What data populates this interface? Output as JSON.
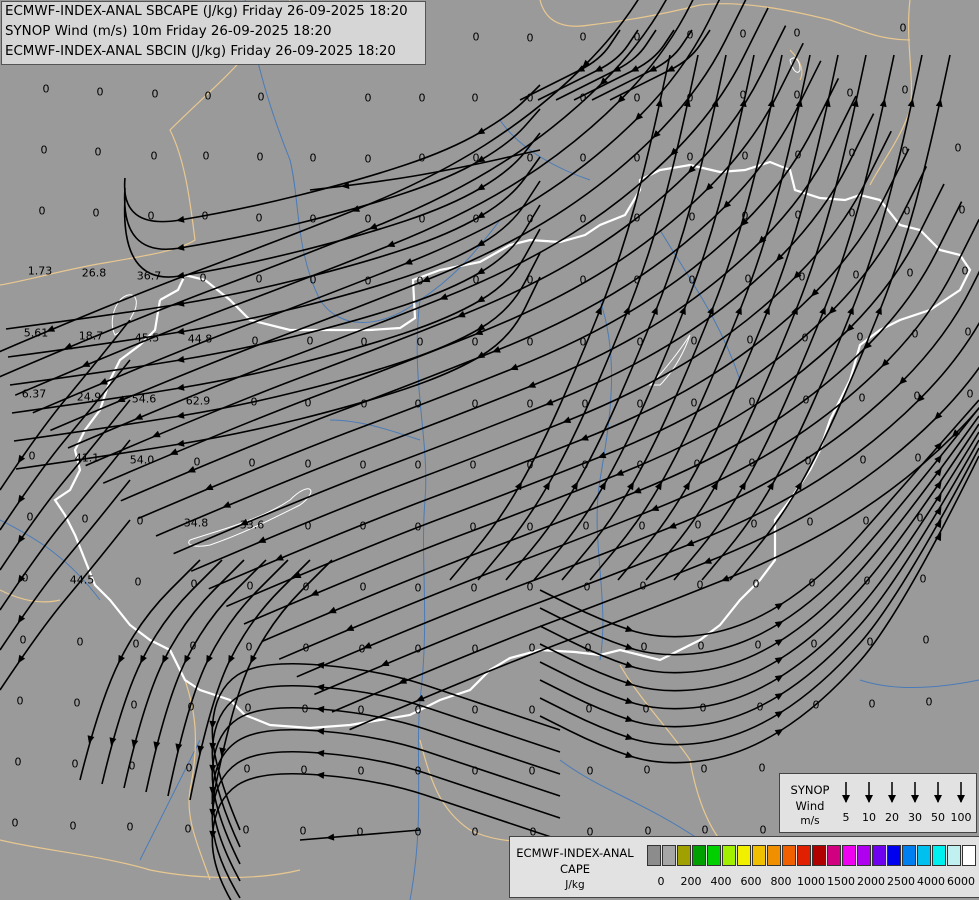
{
  "header": {
    "line1": "ECMWF-INDEX-ANAL SBCAPE (J/kg) Friday 26-09-2025 18:20",
    "line2": "SYNOP Wind (m/s) 10m Friday 26-09-2025 18:20",
    "line3": "ECMWF-INDEX-ANAL SBCIN (J/kg) Friday 26-09-2025 18:20"
  },
  "colors": {
    "map_background": "#9a9a9a",
    "streamline": "#000000",
    "country_border": "#ffffff",
    "neighbor_border": "#e8c890",
    "river": "#4a7bb8"
  },
  "values": [
    {
      "t": "0",
      "p": [
        46,
        89
      ]
    },
    {
      "t": "0",
      "p": [
        100,
        92
      ]
    },
    {
      "t": "0",
      "p": [
        155,
        94
      ]
    },
    {
      "t": "0",
      "p": [
        208,
        96
      ]
    },
    {
      "t": "0",
      "p": [
        261,
        97
      ]
    },
    {
      "t": "0",
      "p": [
        368,
        98
      ]
    },
    {
      "t": "0",
      "p": [
        422,
        98
      ]
    },
    {
      "t": "0",
      "p": [
        475,
        98
      ]
    },
    {
      "t": "0",
      "p": [
        530,
        98
      ]
    },
    {
      "t": "0",
      "p": [
        583,
        98
      ]
    },
    {
      "t": "0",
      "p": [
        637,
        98
      ]
    },
    {
      "t": "0",
      "p": [
        690,
        98
      ]
    },
    {
      "t": "0",
      "p": [
        743,
        95
      ]
    },
    {
      "t": "0",
      "p": [
        797,
        95
      ]
    },
    {
      "t": "0",
      "p": [
        850,
        93
      ]
    },
    {
      "t": "0",
      "p": [
        905,
        90
      ]
    },
    {
      "t": "0",
      "p": [
        476,
        37
      ]
    },
    {
      "t": "0",
      "p": [
        530,
        38
      ]
    },
    {
      "t": "0",
      "p": [
        583,
        37
      ]
    },
    {
      "t": "0",
      "p": [
        637,
        37
      ]
    },
    {
      "t": "0",
      "p": [
        690,
        35
      ]
    },
    {
      "t": "0",
      "p": [
        743,
        34
      ]
    },
    {
      "t": "0",
      "p": [
        797,
        33
      ]
    },
    {
      "t": "0",
      "p": [
        903,
        28
      ]
    },
    {
      "t": "0",
      "p": [
        44,
        150
      ]
    },
    {
      "t": "0",
      "p": [
        98,
        152
      ]
    },
    {
      "t": "0",
      "p": [
        154,
        156
      ]
    },
    {
      "t": "0",
      "p": [
        206,
        156
      ]
    },
    {
      "t": "0",
      "p": [
        260,
        157
      ]
    },
    {
      "t": "0",
      "p": [
        313,
        158
      ]
    },
    {
      "t": "0",
      "p": [
        368,
        159
      ]
    },
    {
      "t": "0",
      "p": [
        422,
        158
      ]
    },
    {
      "t": "0",
      "p": [
        476,
        158
      ]
    },
    {
      "t": "0",
      "p": [
        530,
        158
      ]
    },
    {
      "t": "0",
      "p": [
        583,
        158
      ]
    },
    {
      "t": "0",
      "p": [
        637,
        158
      ]
    },
    {
      "t": "0",
      "p": [
        690,
        157
      ]
    },
    {
      "t": "0",
      "p": [
        745,
        156
      ]
    },
    {
      "t": "0",
      "p": [
        798,
        155
      ]
    },
    {
      "t": "0",
      "p": [
        852,
        153
      ]
    },
    {
      "t": "0",
      "p": [
        905,
        151
      ]
    },
    {
      "t": "0",
      "p": [
        958,
        148
      ]
    },
    {
      "t": "0",
      "p": [
        42,
        211
      ]
    },
    {
      "t": "0",
      "p": [
        96,
        213
      ]
    },
    {
      "t": "0",
      "p": [
        151,
        216
      ]
    },
    {
      "t": "0",
      "p": [
        205,
        216
      ]
    },
    {
      "t": "0",
      "p": [
        259,
        218
      ]
    },
    {
      "t": "0",
      "p": [
        313,
        219
      ]
    },
    {
      "t": "0",
      "p": [
        368,
        219
      ]
    },
    {
      "t": "0",
      "p": [
        422,
        219
      ]
    },
    {
      "t": "0",
      "p": [
        476,
        219
      ]
    },
    {
      "t": "0",
      "p": [
        530,
        219
      ]
    },
    {
      "t": "0",
      "p": [
        583,
        219
      ]
    },
    {
      "t": "0",
      "p": [
        637,
        218
      ]
    },
    {
      "t": "0",
      "p": [
        692,
        217
      ]
    },
    {
      "t": "0",
      "p": [
        745,
        216
      ]
    },
    {
      "t": "0",
      "p": [
        798,
        215
      ]
    },
    {
      "t": "0",
      "p": [
        852,
        213
      ]
    },
    {
      "t": "0",
      "p": [
        907,
        211
      ]
    },
    {
      "t": "0",
      "p": [
        962,
        210
      ]
    },
    {
      "t": "1.73",
      "p": [
        40,
        271
      ]
    },
    {
      "t": "26.8",
      "p": [
        94,
        273
      ]
    },
    {
      "t": "36.7",
      "p": [
        149,
        276
      ]
    },
    {
      "t": "0",
      "p": [
        203,
        278
      ]
    },
    {
      "t": "0",
      "p": [
        259,
        279
      ]
    },
    {
      "t": "0",
      "p": [
        313,
        280
      ]
    },
    {
      "t": "0",
      "p": [
        368,
        281
      ]
    },
    {
      "t": "0",
      "p": [
        420,
        281
      ]
    },
    {
      "t": "0",
      "p": [
        476,
        280
      ]
    },
    {
      "t": "0",
      "p": [
        530,
        280
      ]
    },
    {
      "t": "0",
      "p": [
        583,
        280
      ]
    },
    {
      "t": "0",
      "p": [
        637,
        280
      ]
    },
    {
      "t": "0",
      "p": [
        692,
        280
      ]
    },
    {
      "t": "0",
      "p": [
        748,
        279
      ]
    },
    {
      "t": "0",
      "p": [
        802,
        277
      ]
    },
    {
      "t": "0",
      "p": [
        856,
        275
      ]
    },
    {
      "t": "0",
      "p": [
        910,
        273
      ]
    },
    {
      "t": "0",
      "p": [
        965,
        271
      ]
    },
    {
      "t": "5.61",
      "p": [
        36,
        333
      ]
    },
    {
      "t": "18.7",
      "p": [
        91,
        336
      ]
    },
    {
      "t": "45.5",
      "p": [
        147,
        338
      ]
    },
    {
      "t": "44.8",
      "p": [
        200,
        339
      ]
    },
    {
      "t": "0",
      "p": [
        255,
        341
      ]
    },
    {
      "t": "0",
      "p": [
        310,
        341
      ]
    },
    {
      "t": "0",
      "p": [
        364,
        342
      ]
    },
    {
      "t": "0",
      "p": [
        420,
        342
      ]
    },
    {
      "t": "0",
      "p": [
        475,
        342
      ]
    },
    {
      "t": "0",
      "p": [
        530,
        342
      ]
    },
    {
      "t": "0",
      "p": [
        583,
        342
      ]
    },
    {
      "t": "0",
      "p": [
        640,
        342
      ]
    },
    {
      "t": "0",
      "p": [
        694,
        341
      ]
    },
    {
      "t": "0",
      "p": [
        750,
        340
      ]
    },
    {
      "t": "0",
      "p": [
        805,
        338
      ]
    },
    {
      "t": "0",
      "p": [
        860,
        337
      ]
    },
    {
      "t": "0",
      "p": [
        915,
        334
      ]
    },
    {
      "t": "0",
      "p": [
        968,
        332
      ]
    },
    {
      "t": "6.37",
      "p": [
        34,
        394
      ]
    },
    {
      "t": "24.9",
      "p": [
        89,
        397
      ]
    },
    {
      "t": "54.6",
      "p": [
        144,
        399
      ]
    },
    {
      "t": "62.9",
      "p": [
        198,
        401
      ]
    },
    {
      "t": "0",
      "p": [
        254,
        402
      ]
    },
    {
      "t": "0",
      "p": [
        308,
        403
      ]
    },
    {
      "t": "0",
      "p": [
        364,
        404
      ]
    },
    {
      "t": "0",
      "p": [
        418,
        404
      ]
    },
    {
      "t": "0",
      "p": [
        475,
        404
      ]
    },
    {
      "t": "0",
      "p": [
        530,
        404
      ]
    },
    {
      "t": "0",
      "p": [
        585,
        404
      ]
    },
    {
      "t": "0",
      "p": [
        640,
        404
      ]
    },
    {
      "t": "0",
      "p": [
        694,
        403
      ]
    },
    {
      "t": "0",
      "p": [
        752,
        402
      ]
    },
    {
      "t": "0",
      "p": [
        806,
        400
      ]
    },
    {
      "t": "0",
      "p": [
        862,
        398
      ]
    },
    {
      "t": "0",
      "p": [
        917,
        396
      ]
    },
    {
      "t": "0",
      "p": [
        970,
        394
      ]
    },
    {
      "t": "0",
      "p": [
        32,
        456
      ]
    },
    {
      "t": "41.1",
      "p": [
        87,
        458
      ]
    },
    {
      "t": "54.0",
      "p": [
        142,
        460
      ]
    },
    {
      "t": "0",
      "p": [
        197,
        462
      ]
    },
    {
      "t": "0",
      "p": [
        252,
        463
      ]
    },
    {
      "t": "0",
      "p": [
        308,
        464
      ]
    },
    {
      "t": "0",
      "p": [
        363,
        465
      ]
    },
    {
      "t": "0",
      "p": [
        418,
        465
      ]
    },
    {
      "t": "0",
      "p": [
        473,
        465
      ]
    },
    {
      "t": "0",
      "p": [
        530,
        465
      ]
    },
    {
      "t": "0",
      "p": [
        585,
        465
      ]
    },
    {
      "t": "0",
      "p": [
        640,
        465
      ]
    },
    {
      "t": "0",
      "p": [
        697,
        464
      ]
    },
    {
      "t": "0",
      "p": [
        752,
        463
      ]
    },
    {
      "t": "0",
      "p": [
        808,
        461
      ]
    },
    {
      "t": "0",
      "p": [
        863,
        460
      ]
    },
    {
      "t": "0",
      "p": [
        918,
        458
      ]
    },
    {
      "t": "0",
      "p": [
        30,
        517
      ]
    },
    {
      "t": "0",
      "p": [
        85,
        519
      ]
    },
    {
      "t": "0",
      "p": [
        140,
        521
      ]
    },
    {
      "t": "34.8",
      "p": [
        196,
        523
      ]
    },
    {
      "t": "33.6",
      "p": [
        252,
        525
      ]
    },
    {
      "t": "0",
      "p": [
        308,
        526
      ]
    },
    {
      "t": "0",
      "p": [
        363,
        526
      ]
    },
    {
      "t": "0",
      "p": [
        418,
        527
      ]
    },
    {
      "t": "0",
      "p": [
        473,
        527
      ]
    },
    {
      "t": "0",
      "p": [
        530,
        527
      ]
    },
    {
      "t": "0",
      "p": [
        586,
        526
      ]
    },
    {
      "t": "0",
      "p": [
        642,
        526
      ]
    },
    {
      "t": "0",
      "p": [
        698,
        525
      ]
    },
    {
      "t": "0",
      "p": [
        754,
        524
      ]
    },
    {
      "t": "0",
      "p": [
        810,
        522
      ]
    },
    {
      "t": "0",
      "p": [
        866,
        521
      ]
    },
    {
      "t": "0",
      "p": [
        920,
        518
      ]
    },
    {
      "t": "0",
      "p": [
        25,
        578
      ]
    },
    {
      "t": "44.5",
      "p": [
        82,
        580
      ]
    },
    {
      "t": "0",
      "p": [
        138,
        582
      ]
    },
    {
      "t": "0",
      "p": [
        194,
        584
      ]
    },
    {
      "t": "0",
      "p": [
        250,
        586
      ]
    },
    {
      "t": "0",
      "p": [
        306,
        587
      ]
    },
    {
      "t": "0",
      "p": [
        363,
        587
      ]
    },
    {
      "t": "0",
      "p": [
        418,
        588
      ]
    },
    {
      "t": "0",
      "p": [
        474,
        588
      ]
    },
    {
      "t": "0",
      "p": [
        530,
        587
      ]
    },
    {
      "t": "0",
      "p": [
        587,
        587
      ]
    },
    {
      "t": "0",
      "p": [
        643,
        586
      ]
    },
    {
      "t": "0",
      "p": [
        700,
        585
      ]
    },
    {
      "t": "0",
      "p": [
        756,
        584
      ]
    },
    {
      "t": "0",
      "p": [
        812,
        583
      ]
    },
    {
      "t": "0",
      "p": [
        867,
        581
      ]
    },
    {
      "t": "0",
      "p": [
        923,
        579
      ]
    },
    {
      "t": "0",
      "p": [
        23,
        640
      ]
    },
    {
      "t": "0",
      "p": [
        80,
        642
      ]
    },
    {
      "t": "0",
      "p": [
        136,
        644
      ]
    },
    {
      "t": "0",
      "p": [
        193,
        646
      ]
    },
    {
      "t": "0",
      "p": [
        249,
        647
      ]
    },
    {
      "t": "0",
      "p": [
        306,
        648
      ]
    },
    {
      "t": "0",
      "p": [
        362,
        649
      ]
    },
    {
      "t": "0",
      "p": [
        418,
        649
      ]
    },
    {
      "t": "0",
      "p": [
        475,
        649
      ]
    },
    {
      "t": "0",
      "p": [
        532,
        648
      ]
    },
    {
      "t": "0",
      "p": [
        588,
        648
      ]
    },
    {
      "t": "0",
      "p": [
        644,
        647
      ]
    },
    {
      "t": "0",
      "p": [
        701,
        646
      ]
    },
    {
      "t": "0",
      "p": [
        758,
        645
      ]
    },
    {
      "t": "0",
      "p": [
        814,
        644
      ]
    },
    {
      "t": "0",
      "p": [
        870,
        642
      ]
    },
    {
      "t": "0",
      "p": [
        926,
        640
      ]
    },
    {
      "t": "0",
      "p": [
        20,
        701
      ]
    },
    {
      "t": "0",
      "p": [
        77,
        703
      ]
    },
    {
      "t": "0",
      "p": [
        134,
        705
      ]
    },
    {
      "t": "0",
      "p": [
        191,
        707
      ]
    },
    {
      "t": "0",
      "p": [
        248,
        708
      ]
    },
    {
      "t": "0",
      "p": [
        305,
        709
      ]
    },
    {
      "t": "0",
      "p": [
        361,
        710
      ]
    },
    {
      "t": "0",
      "p": [
        418,
        710
      ]
    },
    {
      "t": "0",
      "p": [
        475,
        710
      ]
    },
    {
      "t": "0",
      "p": [
        532,
        710
      ]
    },
    {
      "t": "0",
      "p": [
        589,
        709
      ]
    },
    {
      "t": "0",
      "p": [
        646,
        709
      ]
    },
    {
      "t": "0",
      "p": [
        703,
        708
      ]
    },
    {
      "t": "0",
      "p": [
        760,
        707
      ]
    },
    {
      "t": "0",
      "p": [
        816,
        705
      ]
    },
    {
      "t": "0",
      "p": [
        872,
        704
      ]
    },
    {
      "t": "0",
      "p": [
        929,
        702
      ]
    },
    {
      "t": "0",
      "p": [
        18,
        762
      ]
    },
    {
      "t": "0",
      "p": [
        75,
        764
      ]
    },
    {
      "t": "0",
      "p": [
        132,
        766
      ]
    },
    {
      "t": "0",
      "p": [
        189,
        768
      ]
    },
    {
      "t": "0",
      "p": [
        247,
        769
      ]
    },
    {
      "t": "0",
      "p": [
        304,
        770
      ]
    },
    {
      "t": "0",
      "p": [
        361,
        771
      ]
    },
    {
      "t": "0",
      "p": [
        418,
        771
      ]
    },
    {
      "t": "0",
      "p": [
        475,
        771
      ]
    },
    {
      "t": "0",
      "p": [
        532,
        771
      ]
    },
    {
      "t": "0",
      "p": [
        590,
        771
      ]
    },
    {
      "t": "0",
      "p": [
        647,
        770
      ]
    },
    {
      "t": "0",
      "p": [
        704,
        769
      ]
    },
    {
      "t": "0",
      "p": [
        762,
        768
      ]
    },
    {
      "t": "0",
      "p": [
        15,
        823
      ]
    },
    {
      "t": "0",
      "p": [
        73,
        826
      ]
    },
    {
      "t": "0",
      "p": [
        130,
        827
      ]
    },
    {
      "t": "0",
      "p": [
        188,
        829
      ]
    },
    {
      "t": "0",
      "p": [
        246,
        830
      ]
    },
    {
      "t": "0",
      "p": [
        303,
        831
      ]
    },
    {
      "t": "0",
      "p": [
        360,
        832
      ]
    },
    {
      "t": "0",
      "p": [
        418,
        832
      ]
    },
    {
      "t": "0",
      "p": [
        475,
        832
      ]
    },
    {
      "t": "0",
      "p": [
        533,
        832
      ]
    },
    {
      "t": "0",
      "p": [
        590,
        832
      ]
    },
    {
      "t": "0",
      "p": [
        648,
        831
      ]
    },
    {
      "t": "0",
      "p": [
        705,
        830
      ]
    },
    {
      "t": "0",
      "p": [
        763,
        830
      ]
    },
    {
      "t": "0",
      "p": [
        820,
        828
      ]
    },
    {
      "t": "0",
      "p": [
        877,
        827
      ]
    },
    {
      "t": "0",
      "p": [
        934,
        826
      ]
    }
  ],
  "legend_wind": {
    "title1": "SYNOP",
    "title2": "Wind",
    "units": "m/s",
    "speeds": [
      "5",
      "10",
      "20",
      "30",
      "50",
      "100"
    ]
  },
  "legend_cape": {
    "title1": "ECMWF-INDEX-ANAL",
    "title2": "CAPE",
    "units": "J/kg",
    "colors": [
      "#8c8c8c",
      "#a6a6a6",
      "#a0a000",
      "#00a000",
      "#00d000",
      "#a0f000",
      "#f0f000",
      "#f0c000",
      "#f09000",
      "#f06000",
      "#e02000",
      "#b00000",
      "#d00080",
      "#f000f0",
      "#b000f0",
      "#7000f0",
      "#0000f0",
      "#0080f0",
      "#00c0f0",
      "#00f0f0",
      "#c0f0f0",
      "#ffffff"
    ],
    "ticks": [
      "0",
      "200",
      "400",
      "600",
      "800",
      "1000",
      "1500",
      "2000",
      "2500",
      "4000",
      "6000"
    ]
  }
}
